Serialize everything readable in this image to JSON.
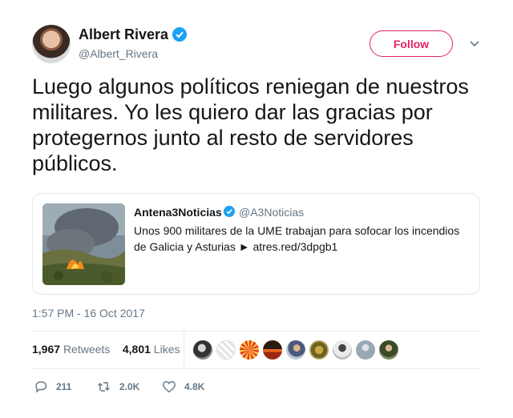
{
  "author": {
    "name": "Albert Rivera",
    "handle": "@Albert_Rivera",
    "verified": true
  },
  "follow_label": "Follow",
  "tweet_text": "Luego algunos políticos reniegan de nuestros militares. Yo les quiero dar las gracias por protegernos junto al resto de servidores públicos.",
  "quoted": {
    "name": "Antena3Noticias",
    "handle": "@A3Noticias",
    "verified": true,
    "text": "Unos 900 militares de la UME trabajan para sofocar los incendios de Galicia y Asturias ► atres.red/3dpgb1"
  },
  "timestamp": "1:57 PM - 16 Oct 2017",
  "stats": {
    "retweets_count": "1,967",
    "retweets_label": "Retweets",
    "likes_count": "4,801",
    "likes_label": "Likes"
  },
  "actions": {
    "replies": "211",
    "retweets": "2.0K",
    "likes": "4.8K"
  },
  "colors": {
    "accent": "#1da1f2",
    "follow": "#e0245e",
    "muted": "#657786"
  }
}
